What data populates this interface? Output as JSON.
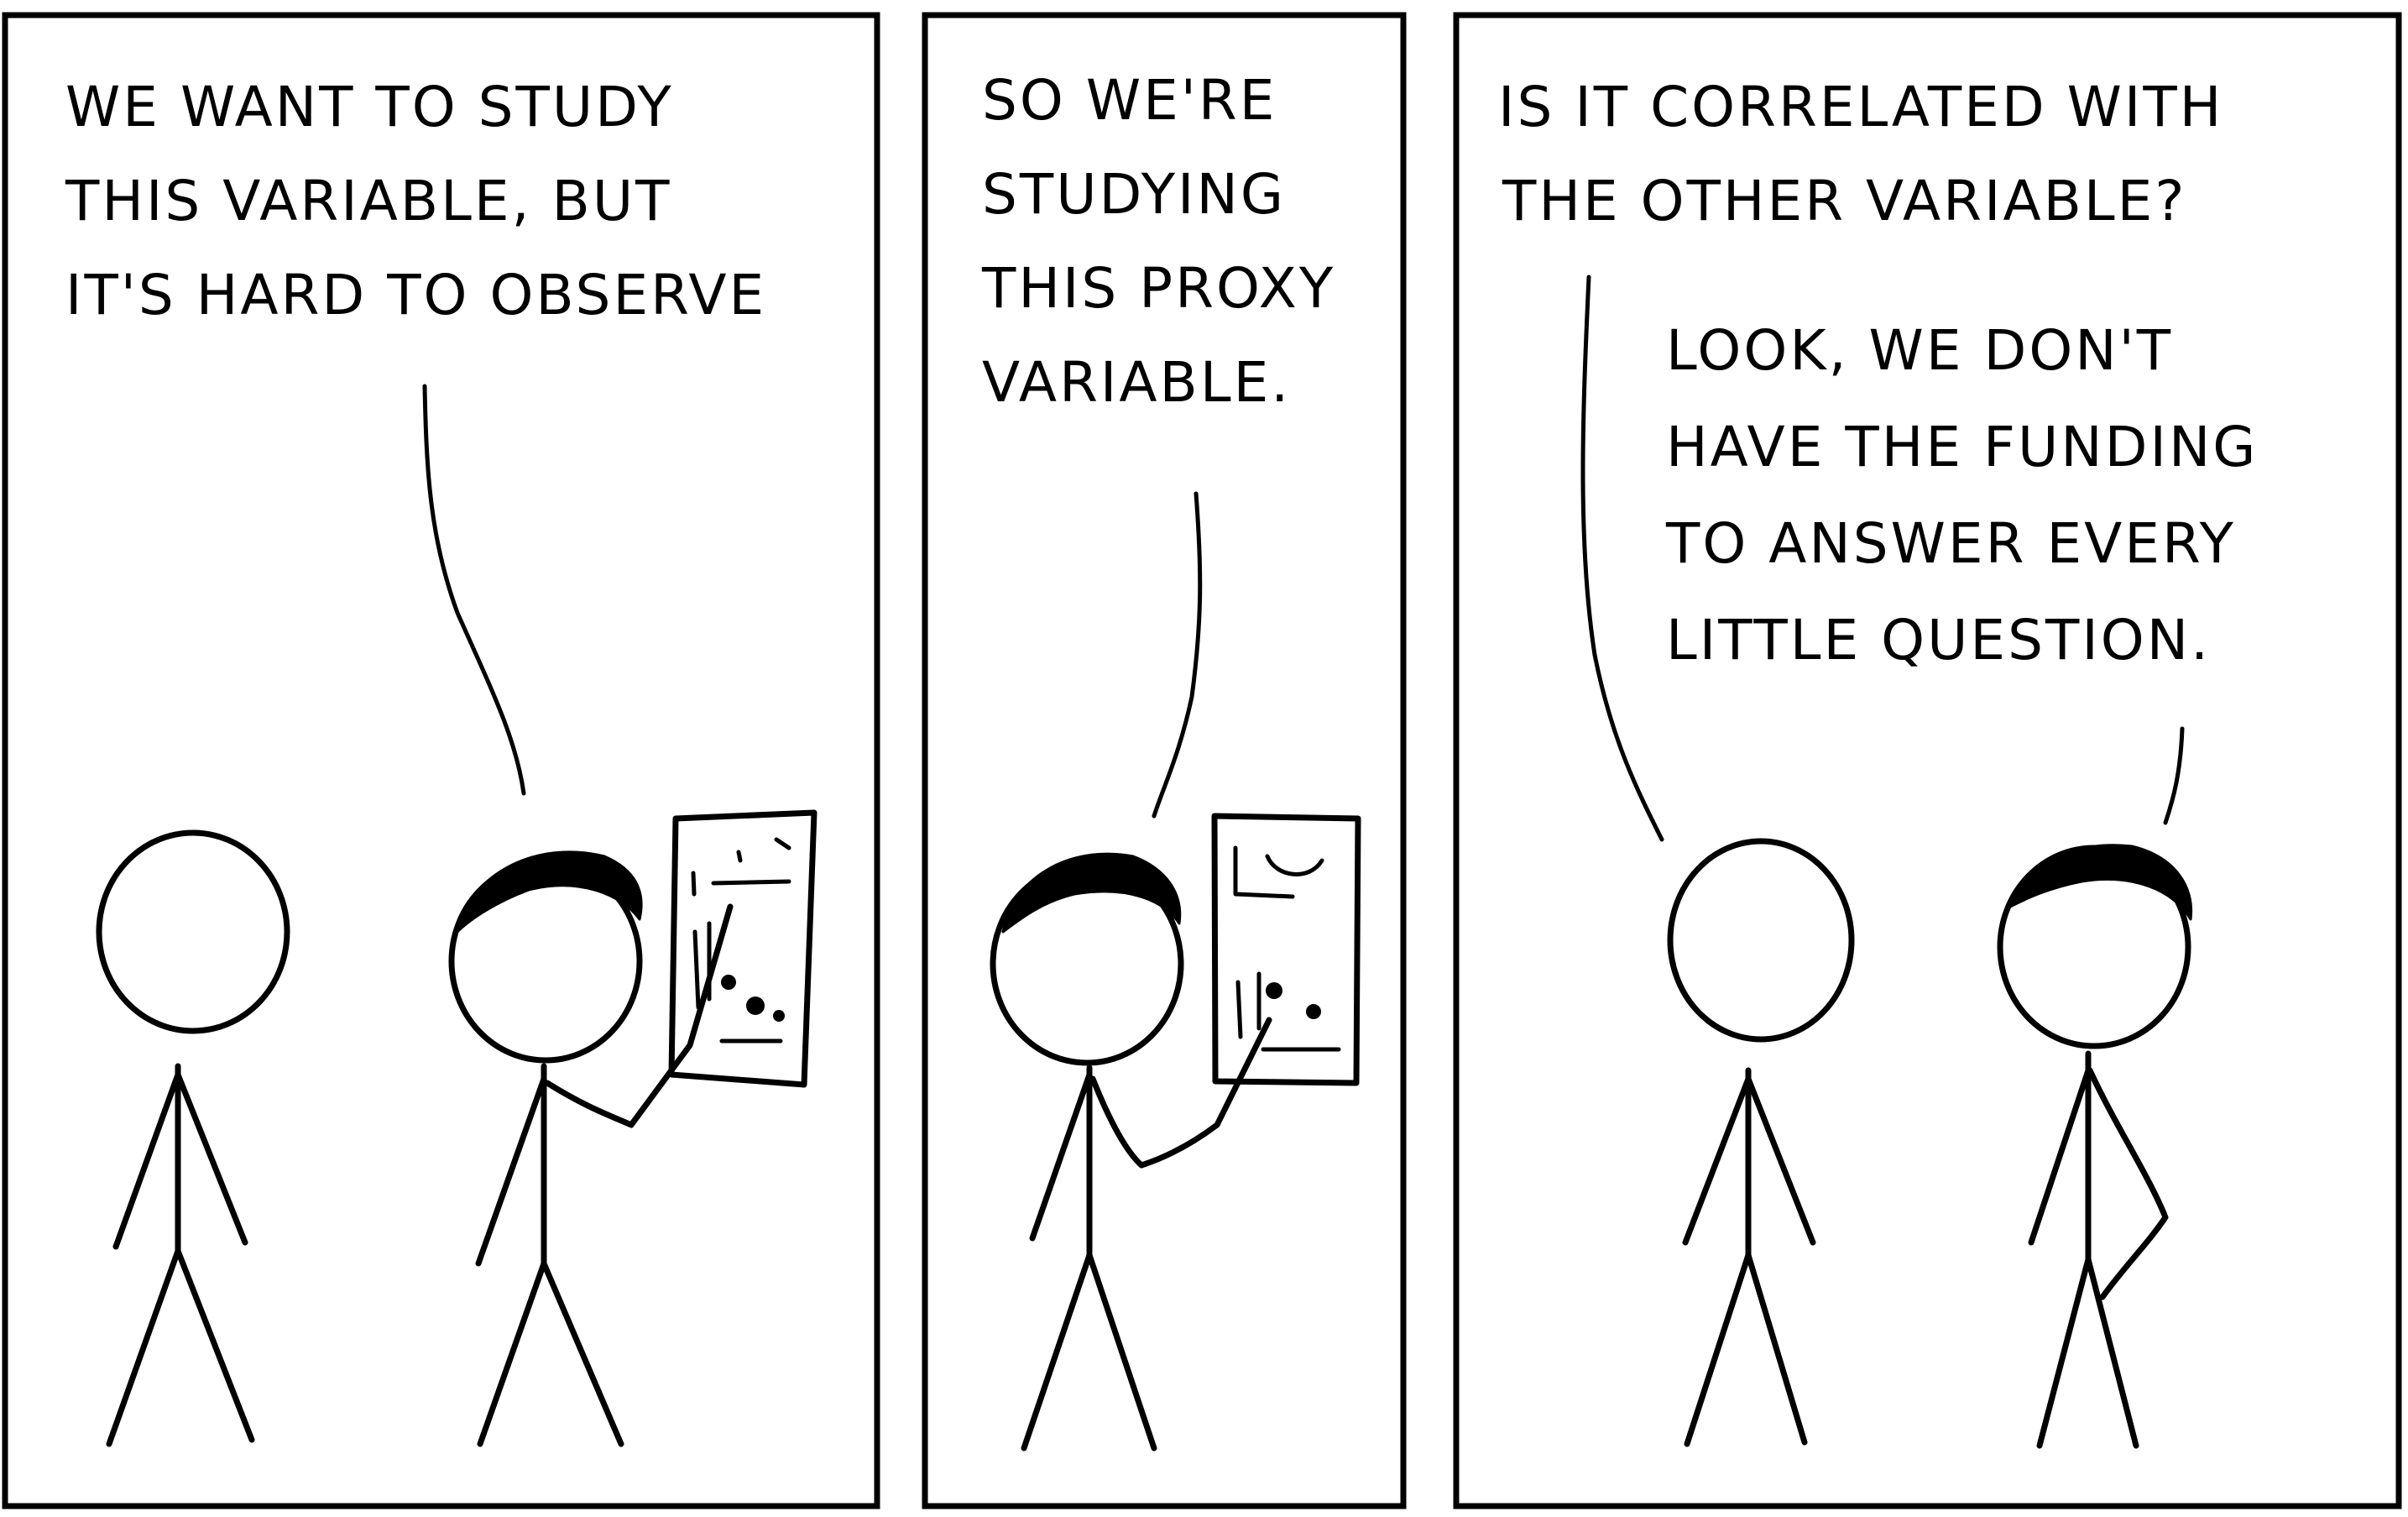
{
  "panels": [
    {
      "id": "panel-1",
      "lines": [
        "WE WANT TO STUDY",
        "THIS VARIABLE, BUT",
        "IT'S HARD TO OBSERVE"
      ]
    },
    {
      "id": "panel-2",
      "lines": [
        "SO WE'RE",
        "STUDYING",
        "THIS PROXY",
        "VARIABLE."
      ]
    },
    {
      "id": "panel-3",
      "question_lines": [
        "IS IT CORRELATED WITH",
        "THE OTHER VARIABLE?"
      ],
      "reply_lines": [
        "LOOK, WE DON'T",
        "HAVE THE FUNDING",
        "TO ANSWER EVERY",
        "LITTLE QUESTION."
      ]
    }
  ],
  "colors": {
    "ink": "#000000",
    "paper": "#ffffff"
  }
}
